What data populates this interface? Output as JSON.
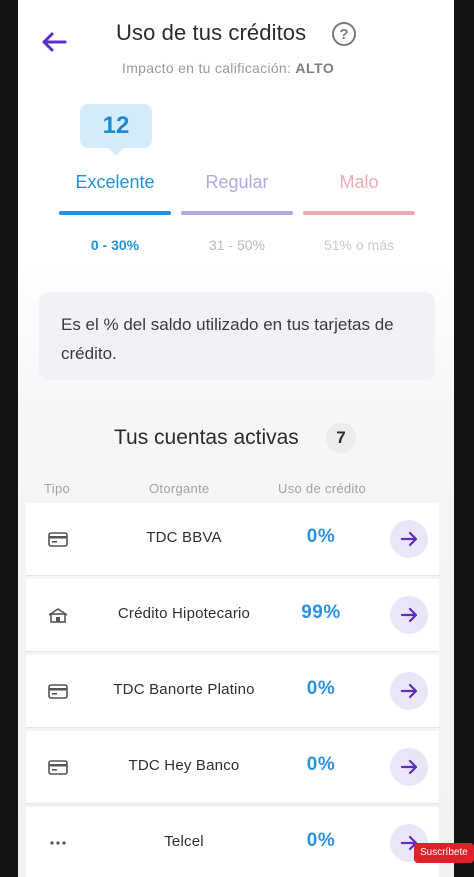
{
  "header": {
    "title": "Uso de tus créditos",
    "help_symbol": "?",
    "subtitle_prefix": "Impacto en tu calificación:",
    "impact_value": "ALTO"
  },
  "score": {
    "value": "12",
    "selected_category": "Excelente"
  },
  "categories": [
    {
      "label": "Excelente",
      "range": "0 - 30%",
      "color": "#1f93dc",
      "bar_color": "#1f93dc"
    },
    {
      "label": "Regular",
      "range": "31 - 50%",
      "color": "#b4a7e6",
      "bar_color": "#b4a7e6"
    },
    {
      "label": "Malo",
      "range": "51% o más",
      "color": "#f0a9b2",
      "bar_color": "#f0a9b2"
    }
  ],
  "info_text": "Es el % del saldo utilizado en tus tarjetas de crédito.",
  "accounts": {
    "title": "Tus cuentas activas",
    "count": "7",
    "columns": [
      "Tipo",
      "Otorgante",
      "Uso de crédito"
    ],
    "rows": [
      {
        "icon": "credit-card-icon",
        "name": "TDC BBVA",
        "usage": "0%"
      },
      {
        "icon": "house-icon",
        "name": "Crédito Hipotecario",
        "usage": "99%"
      },
      {
        "icon": "credit-card-icon",
        "name": "TDC Banorte Platino",
        "usage": "0%"
      },
      {
        "icon": "credit-card-icon",
        "name": "TDC Hey Banco",
        "usage": "0%"
      },
      {
        "icon": "more-dots-icon",
        "name": "Telcel",
        "usage": "0%"
      }
    ]
  },
  "overlay": {
    "subscribe_label": "Suscríbete"
  },
  "colors": {
    "accent_purple": "#5b2fc4",
    "usage_blue": "#2a93dd"
  }
}
